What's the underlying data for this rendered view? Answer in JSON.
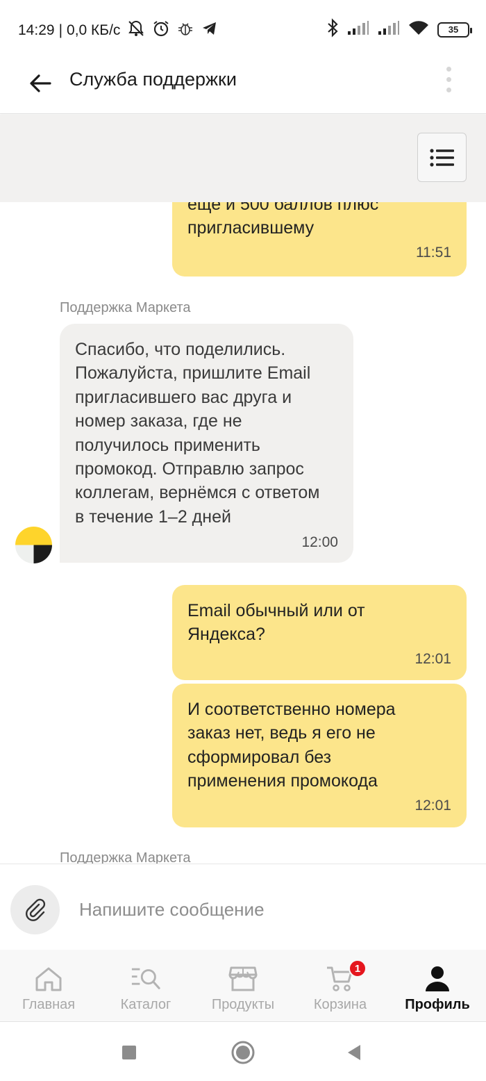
{
  "status_bar": {
    "time": "14:29",
    "separator": "|",
    "net_speed": "0,0 КБ/с",
    "battery_level": "35"
  },
  "header": {
    "title": "Службa поддержки"
  },
  "chat": {
    "messages": [
      {
        "from": "user",
        "text": "еще и 500 баллов плюс\nпригласившему",
        "time": "11:51"
      },
      {
        "from": "support",
        "sender": "Поддержка Маркета",
        "text": "Спасибо, что поделились.\nПожалуйста, пришлите Email\nпригласившего вас друга и\nномер заказа, где не\nполучилось применить\nпромокод. Отправлю запрос\nколлегам, вернёмся с ответом\nв течение 1–2 дней",
        "time": "12:00"
      },
      {
        "from": "user",
        "text": "Email обычный или от\nЯндекса?",
        "time": "12:01"
      },
      {
        "from": "user",
        "text": "И соответственно номера\nзаказ нет, ведь я его не\nсформировал без\nприменения промокода",
        "time": "12:01"
      },
      {
        "from": "support",
        "sender": "Поддержка Маркета"
      }
    ]
  },
  "input": {
    "placeholder": "Напишите сообщение"
  },
  "bottom_nav": {
    "items": [
      {
        "label": "Главная",
        "icon": "home-icon"
      },
      {
        "label": "Каталог",
        "icon": "catalog-search-icon"
      },
      {
        "label": "Продукты",
        "icon": "store-icon"
      },
      {
        "label": "Корзина",
        "icon": "cart-icon",
        "badge": "1"
      },
      {
        "label": "Профиль",
        "icon": "person-icon",
        "active": true
      }
    ]
  },
  "colors": {
    "user_bubble": "#fce58b",
    "support_bubble": "#f1f0ee",
    "badge": "#e5161e",
    "brand_yellow": "#fed42b"
  }
}
